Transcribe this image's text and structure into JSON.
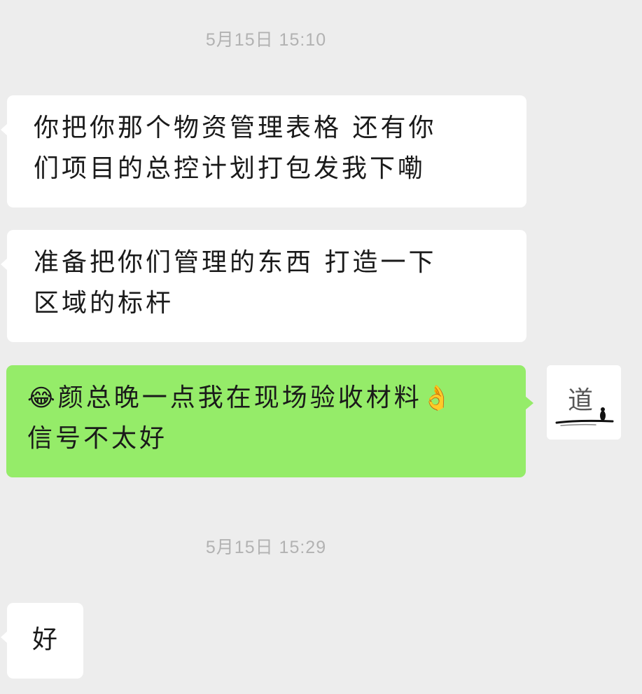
{
  "timestamps": [
    "5月15日 15:10",
    "5月15日 15:29"
  ],
  "messages": [
    {
      "side": "left",
      "lines": [
        "你把你那个物资管理表格 还有你",
        "们项目的总控计划打包发我下嘞"
      ]
    },
    {
      "side": "left",
      "lines": [
        "准备把你们管理的东西 打造一下",
        "区域的标杆"
      ]
    },
    {
      "side": "right",
      "emoji_start": "😂",
      "line1": "颜总晚一点我在现场验收材料",
      "emoji_end": "👌",
      "line2": "信号不太好"
    },
    {
      "side": "left",
      "lines": [
        "好"
      ]
    }
  ],
  "avatar": {
    "icon": "calligraphy-avatar-icon",
    "glyph": "道"
  },
  "colors": {
    "background": "#ededed",
    "incoming_bubble": "#ffffff",
    "outgoing_bubble": "#95ec69",
    "timestamp": "#b2b2b2",
    "text": "#1a1a1a"
  }
}
